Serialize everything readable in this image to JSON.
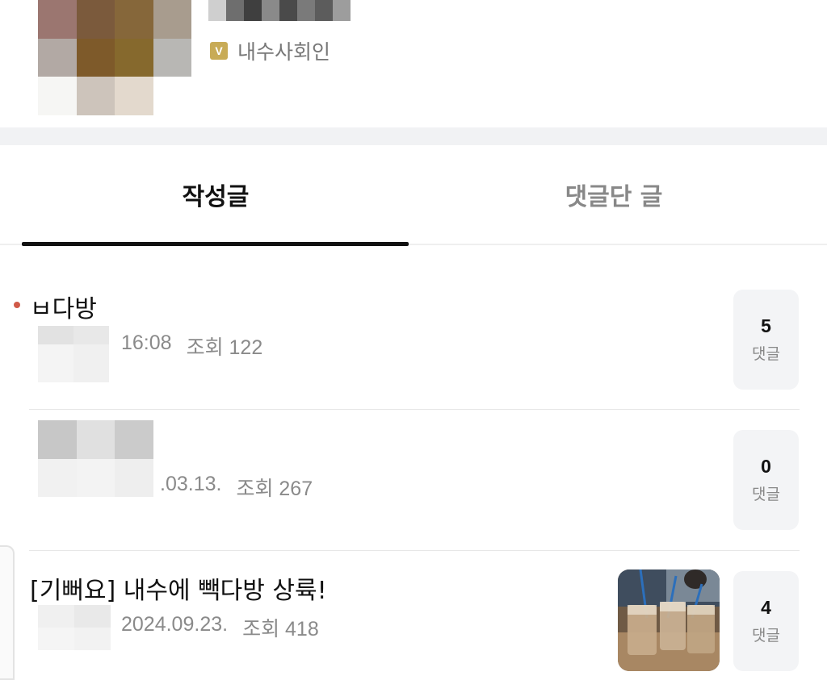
{
  "profile": {
    "rank_badge": "V",
    "rank_label": "내수사회인"
  },
  "tabs": {
    "posts": "작성글",
    "comments": "댓글단 글"
  },
  "posts": [
    {
      "title": "ㅂ다방",
      "time": "16:08",
      "views": "조회 122",
      "comment_count": "5",
      "comment_label": "댓글"
    },
    {
      "title": "",
      "time": ".03.13.",
      "views": "조회 267",
      "comment_count": "0",
      "comment_label": "댓글"
    },
    {
      "title": "[기뻐요] 내수에 빽다방 상륙!",
      "time": "2024.09.23.",
      "views": "조회 418",
      "comment_count": "4",
      "comment_label": "댓글",
      "thumbnail": "iced-coffee-cups-photo"
    }
  ],
  "colors": {
    "new_dot": "#d05a48",
    "rank_badge": "#c8ab56",
    "active_tab_underline": "#111111"
  }
}
